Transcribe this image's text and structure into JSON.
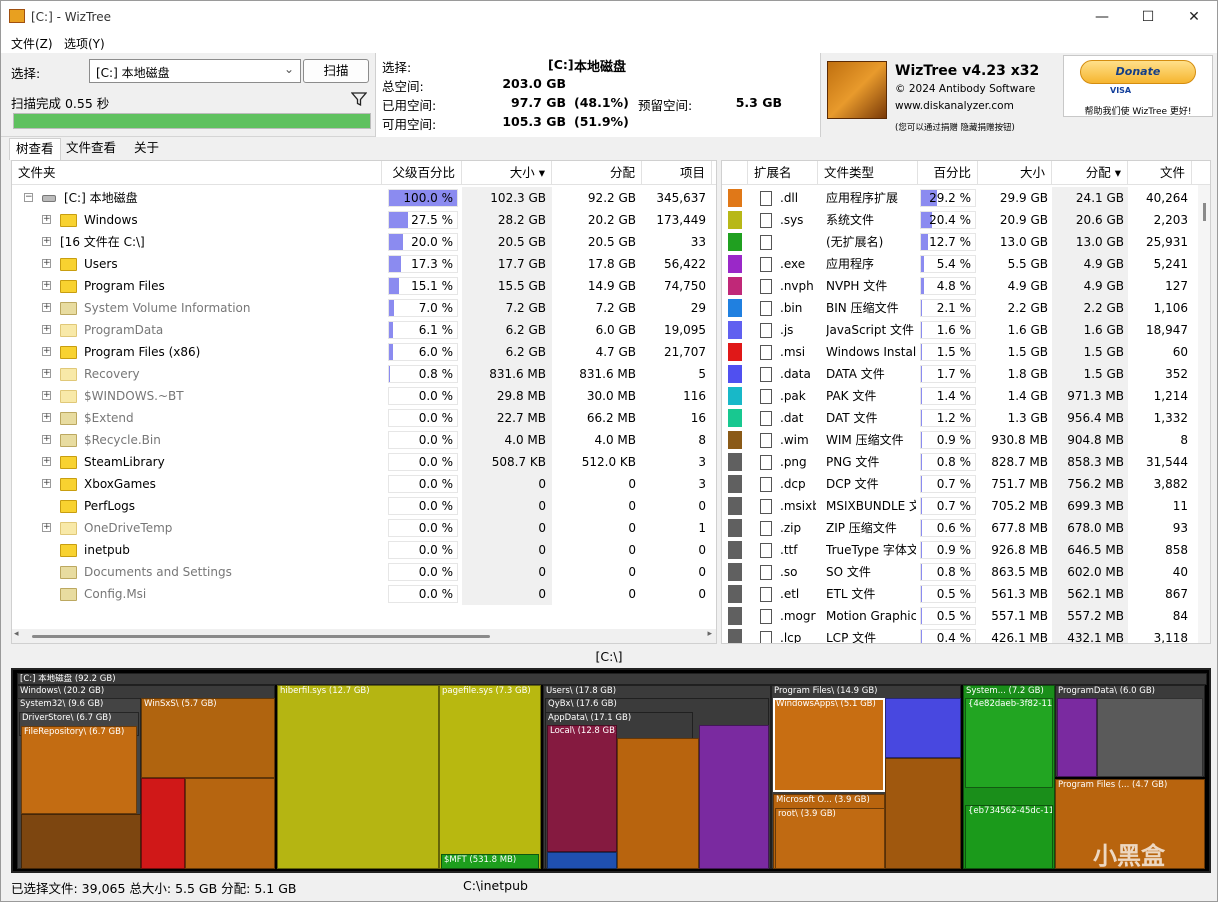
{
  "window": {
    "title": "[C:] - WizTree",
    "min": "—",
    "max": "☐",
    "close": "✕"
  },
  "menu": [
    "文件(Z)",
    "选项(Y)"
  ],
  "scan": {
    "select_label": "选择:",
    "drive": "[C:] 本地磁盘",
    "scan_button": "扫描",
    "status": "扫描完成 0.55 秒",
    "progress": 1.0
  },
  "info": {
    "select_label": "选择:",
    "drive_code": "[C:]",
    "drive_name": "本地磁盘",
    "total_label": "总空间:",
    "total": "203.0 GB",
    "used_label": "已用空间:",
    "used": "97.7 GB",
    "used_pct": "(48.1%)",
    "reserved_label": "预留空间:",
    "reserved": "5.3 GB",
    "free_label": "可用空间:",
    "free": "105.3 GB",
    "free_pct": "(51.9%)"
  },
  "brand": {
    "name": "WizTree v4.23 x32",
    "copyright": "© 2024 Antibody Software",
    "url": "www.diskanalyzer.com",
    "note": "(您可以通过捐赠 隐藏捐赠按钮)",
    "donate": "Donate",
    "cards": "VISA",
    "donate_sub": "帮助我们使 WizTree 更好!"
  },
  "tabs": [
    "树查看",
    "文件查看",
    "关于"
  ],
  "tree": {
    "headers": [
      "文件夹",
      "父级百分比",
      "大小 ▾",
      "分配",
      "项目"
    ],
    "rows": [
      {
        "name": "[C:] 本地磁盘",
        "pct": "100.0 %",
        "p": 1.0,
        "size": "102.3 GB",
        "alloc": "92.2 GB",
        "items": "345,637",
        "depth": 0,
        "type": "drive",
        "expander": "−"
      },
      {
        "name": "Windows",
        "pct": "27.5 %",
        "p": 0.275,
        "size": "28.2 GB",
        "alloc": "20.2 GB",
        "items": "173,449",
        "depth": 1,
        "type": "folder",
        "expander": "+"
      },
      {
        "name": "[16 文件在 C:\\]",
        "pct": "20.0 %",
        "p": 0.2,
        "size": "20.5 GB",
        "alloc": "20.5 GB",
        "items": "33",
        "depth": 1,
        "type": "files",
        "expander": "+"
      },
      {
        "name": "Users",
        "pct": "17.3 %",
        "p": 0.173,
        "size": "17.7 GB",
        "alloc": "17.8 GB",
        "items": "56,422",
        "depth": 1,
        "type": "folder",
        "expander": "+"
      },
      {
        "name": "Program Files",
        "pct": "15.1 %",
        "p": 0.151,
        "size": "15.5 GB",
        "alloc": "14.9 GB",
        "items": "74,750",
        "depth": 1,
        "type": "folder",
        "expander": "+"
      },
      {
        "name": "System Volume Information",
        "pct": "7.0 %",
        "p": 0.07,
        "size": "7.2 GB",
        "alloc": "7.2 GB",
        "items": "29",
        "depth": 1,
        "type": "sys",
        "expander": "+"
      },
      {
        "name": "ProgramData",
        "pct": "6.1 %",
        "p": 0.061,
        "size": "6.2 GB",
        "alloc": "6.0 GB",
        "items": "19,095",
        "depth": 1,
        "type": "ghost",
        "expander": "+"
      },
      {
        "name": "Program Files (x86)",
        "pct": "6.0 %",
        "p": 0.06,
        "size": "6.2 GB",
        "alloc": "4.7 GB",
        "items": "21,707",
        "depth": 1,
        "type": "folder",
        "expander": "+"
      },
      {
        "name": "Recovery",
        "pct": "0.8 %",
        "p": 0.008,
        "size": "831.6 MB",
        "alloc": "831.6 MB",
        "items": "5",
        "depth": 1,
        "type": "ghost",
        "expander": "+"
      },
      {
        "name": "$WINDOWS.~BT",
        "pct": "0.0 %",
        "p": 0,
        "size": "29.8 MB",
        "alloc": "30.0 MB",
        "items": "116",
        "depth": 1,
        "type": "ghost",
        "expander": "+"
      },
      {
        "name": "$Extend",
        "pct": "0.0 %",
        "p": 0,
        "size": "22.7 MB",
        "alloc": "66.2 MB",
        "items": "16",
        "depth": 1,
        "type": "sys",
        "expander": "+"
      },
      {
        "name": "$Recycle.Bin",
        "pct": "0.0 %",
        "p": 0,
        "size": "4.0 MB",
        "alloc": "4.0 MB",
        "items": "8",
        "depth": 1,
        "type": "sys",
        "expander": "+"
      },
      {
        "name": "SteamLibrary",
        "pct": "0.0 %",
        "p": 0,
        "size": "508.7 KB",
        "alloc": "512.0 KB",
        "items": "3",
        "depth": 1,
        "type": "folder",
        "expander": "+"
      },
      {
        "name": "XboxGames",
        "pct": "0.0 %",
        "p": 0,
        "size": "0",
        "alloc": "0",
        "items": "3",
        "depth": 1,
        "type": "folder",
        "expander": "+"
      },
      {
        "name": "PerfLogs",
        "pct": "0.0 %",
        "p": 0,
        "size": "0",
        "alloc": "0",
        "items": "0",
        "depth": 1,
        "type": "folder",
        "expander": ""
      },
      {
        "name": "OneDriveTemp",
        "pct": "0.0 %",
        "p": 0,
        "size": "0",
        "alloc": "0",
        "items": "1",
        "depth": 1,
        "type": "ghost",
        "expander": "+"
      },
      {
        "name": "inetpub",
        "pct": "0.0 %",
        "p": 0,
        "size": "0",
        "alloc": "0",
        "items": "0",
        "depth": 1,
        "type": "folder",
        "expander": ""
      },
      {
        "name": "Documents and Settings",
        "pct": "0.0 %",
        "p": 0,
        "size": "0",
        "alloc": "0",
        "items": "0",
        "depth": 1,
        "type": "sys",
        "expander": ""
      },
      {
        "name": "Config.Msi",
        "pct": "0.0 %",
        "p": 0,
        "size": "0",
        "alloc": "0",
        "items": "0",
        "depth": 1,
        "type": "sys",
        "expander": ""
      }
    ]
  },
  "ext": {
    "headers": [
      "扩展名",
      "文件类型",
      "百分比",
      "大小",
      "分配 ▾",
      "文件"
    ],
    "rows": [
      {
        "color": "#e07818",
        "ext": ".dll",
        "type": "应用程序扩展",
        "pct": "29.2 %",
        "p": 0.292,
        "size": "29.9 GB",
        "alloc": "24.1 GB",
        "files": "40,264"
      },
      {
        "color": "#b8b818",
        "ext": ".sys",
        "type": "系统文件",
        "pct": "20.4 %",
        "p": 0.204,
        "size": "20.9 GB",
        "alloc": "20.6 GB",
        "files": "2,203"
      },
      {
        "color": "#20a020",
        "ext": "",
        "type": "(无扩展名)",
        "pct": "12.7 %",
        "p": 0.127,
        "size": "13.0 GB",
        "alloc": "13.0 GB",
        "files": "25,931"
      },
      {
        "color": "#9a28c8",
        "ext": ".exe",
        "type": "应用程序",
        "pct": "5.4 %",
        "p": 0.054,
        "size": "5.5 GB",
        "alloc": "4.9 GB",
        "files": "5,241"
      },
      {
        "color": "#c02878",
        "ext": ".nvph",
        "type": "NVPH 文件",
        "pct": "4.8 %",
        "p": 0.048,
        "size": "4.9 GB",
        "alloc": "4.9 GB",
        "files": "127"
      },
      {
        "color": "#2080e0",
        "ext": ".bin",
        "type": "BIN 压缩文件",
        "pct": "2.1 %",
        "p": 0.021,
        "size": "2.2 GB",
        "alloc": "2.2 GB",
        "files": "1,106"
      },
      {
        "color": "#6060f0",
        "ext": ".js",
        "type": "JavaScript 文件",
        "pct": "1.6 %",
        "p": 0.016,
        "size": "1.6 GB",
        "alloc": "1.6 GB",
        "files": "18,947"
      },
      {
        "color": "#e01818",
        "ext": ".msi",
        "type": "Windows Installe",
        "pct": "1.5 %",
        "p": 0.015,
        "size": "1.5 GB",
        "alloc": "1.5 GB",
        "files": "60"
      },
      {
        "color": "#5050f0",
        "ext": ".data",
        "type": "DATA 文件",
        "pct": "1.7 %",
        "p": 0.017,
        "size": "1.8 GB",
        "alloc": "1.5 GB",
        "files": "352"
      },
      {
        "color": "#18b8c8",
        "ext": ".pak",
        "type": "PAK 文件",
        "pct": "1.4 %",
        "p": 0.014,
        "size": "1.4 GB",
        "alloc": "971.3 MB",
        "files": "1,214"
      },
      {
        "color": "#18c890",
        "ext": ".dat",
        "type": "DAT 文件",
        "pct": "1.2 %",
        "p": 0.012,
        "size": "1.3 GB",
        "alloc": "956.4 MB",
        "files": "1,332"
      },
      {
        "color": "#8a5a18",
        "ext": ".wim",
        "type": "WIM 压缩文件",
        "pct": "0.9 %",
        "p": 0.009,
        "size": "930.8 MB",
        "alloc": "904.8 MB",
        "files": "8"
      },
      {
        "color": "#606060",
        "ext": ".png",
        "type": "PNG 文件",
        "pct": "0.8 %",
        "p": 0.008,
        "size": "828.7 MB",
        "alloc": "858.3 MB",
        "files": "31,544"
      },
      {
        "color": "#606060",
        "ext": ".dcp",
        "type": "DCP 文件",
        "pct": "0.7 %",
        "p": 0.007,
        "size": "751.7 MB",
        "alloc": "756.2 MB",
        "files": "3,882"
      },
      {
        "color": "#606060",
        "ext": ".msixbundle",
        "type": "MSIXBUNDLE 文",
        "pct": "0.7 %",
        "p": 0.007,
        "size": "705.2 MB",
        "alloc": "699.3 MB",
        "files": "11"
      },
      {
        "color": "#606060",
        "ext": ".zip",
        "type": "ZIP 压缩文件",
        "pct": "0.6 %",
        "p": 0.006,
        "size": "677.8 MB",
        "alloc": "678.0 MB",
        "files": "93"
      },
      {
        "color": "#606060",
        "ext": ".ttf",
        "type": "TrueType 字体文",
        "pct": "0.9 %",
        "p": 0.009,
        "size": "926.8 MB",
        "alloc": "646.5 MB",
        "files": "858"
      },
      {
        "color": "#606060",
        "ext": ".so",
        "type": "SO 文件",
        "pct": "0.8 %",
        "p": 0.008,
        "size": "863.5 MB",
        "alloc": "602.0 MB",
        "files": "40"
      },
      {
        "color": "#606060",
        "ext": ".etl",
        "type": "ETL 文件",
        "pct": "0.5 %",
        "p": 0.005,
        "size": "561.3 MB",
        "alloc": "562.1 MB",
        "files": "867"
      },
      {
        "color": "#606060",
        "ext": ".mogrt",
        "type": "Motion Graphics",
        "pct": "0.5 %",
        "p": 0.005,
        "size": "557.1 MB",
        "alloc": "557.2 MB",
        "files": "84"
      },
      {
        "color": "#606060",
        "ext": ".lcp",
        "type": "LCP 文件",
        "pct": "0.4 %",
        "p": 0.004,
        "size": "426.1 MB",
        "alloc": "432.1 MB",
        "files": "3,118"
      }
    ]
  },
  "path": "[C:\\]",
  "treemap": {
    "labels": [
      "[C:] 本地磁盘 (92.2 GB)",
      "Windows\\ (20.2 GB)",
      "System32\\ (9.6 GB)",
      "DriverStore\\ (6.7 GB)",
      "FileRepository\\ (6.7 GB)",
      "WinSxS\\ (5.7 GB)",
      "hiberfil.sys (12.7 GB)",
      "pagefile.sys (7.3 GB)",
      "$MFT (531.8 MB)",
      "Users\\ (17.8 GB)",
      "QyBx\\ (17.6 GB)",
      "AppData\\ (17.1 GB)",
      "Local\\ (12.8 GB)",
      "Program Files\\ (14.9 GB)",
      "WindowsApps\\ (5.1 GB)",
      "Microsoft O... (3.9 GB)",
      "root\\ (3.9 GB)",
      "System... (7.2 GB)",
      "{4e82daeb-3f82-11f (4.6 GB)",
      "{eb734562-45dc-11f (2.6 GB)",
      "ProgramData\\ (6.0 GB)",
      "Program Files (... (4.7 GB)"
    ]
  },
  "status": {
    "left": "已选择文件: 39,065  总大小: 5.5 GB  分配: 5.1 GB",
    "path": "C:\\inetpub"
  },
  "watermark": "小黑盒"
}
